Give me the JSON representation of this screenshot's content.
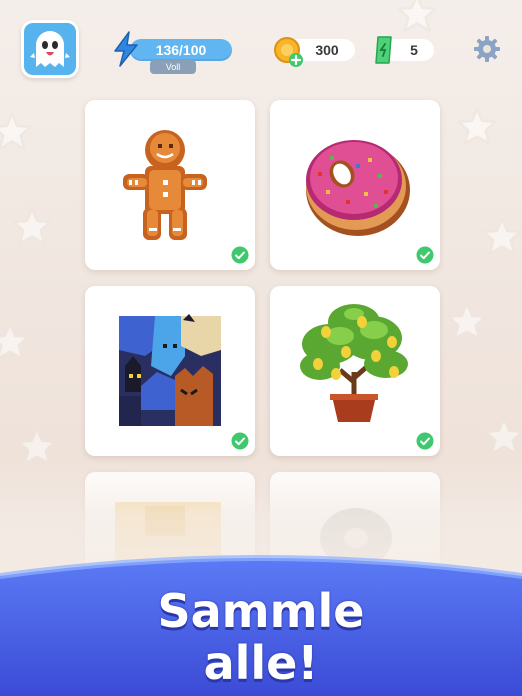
{
  "header": {
    "energy": {
      "value": "136/100",
      "badge": "Voll",
      "icon": "lightning-icon"
    },
    "coins": {
      "value": "300",
      "icon": "coin-plus-icon"
    },
    "tickets": {
      "value": "5",
      "icon": "ticket-icon"
    },
    "settings_icon": "gear-icon",
    "avatar_icon": "ghost-icon"
  },
  "gallery": {
    "cards": [
      {
        "name": "gingerbread",
        "completed": true
      },
      {
        "name": "donut",
        "completed": true
      },
      {
        "name": "cats",
        "completed": true
      },
      {
        "name": "tree",
        "completed": true
      },
      {
        "name": "faded-1",
        "completed": false
      },
      {
        "name": "faded-2",
        "completed": false
      }
    ]
  },
  "banner": {
    "line1": "Sammle",
    "line2": "alle!"
  },
  "colors": {
    "accent_blue": "#4a5ee8",
    "energy_blue": "#61b6f2",
    "check_green": "#3fc86d"
  }
}
